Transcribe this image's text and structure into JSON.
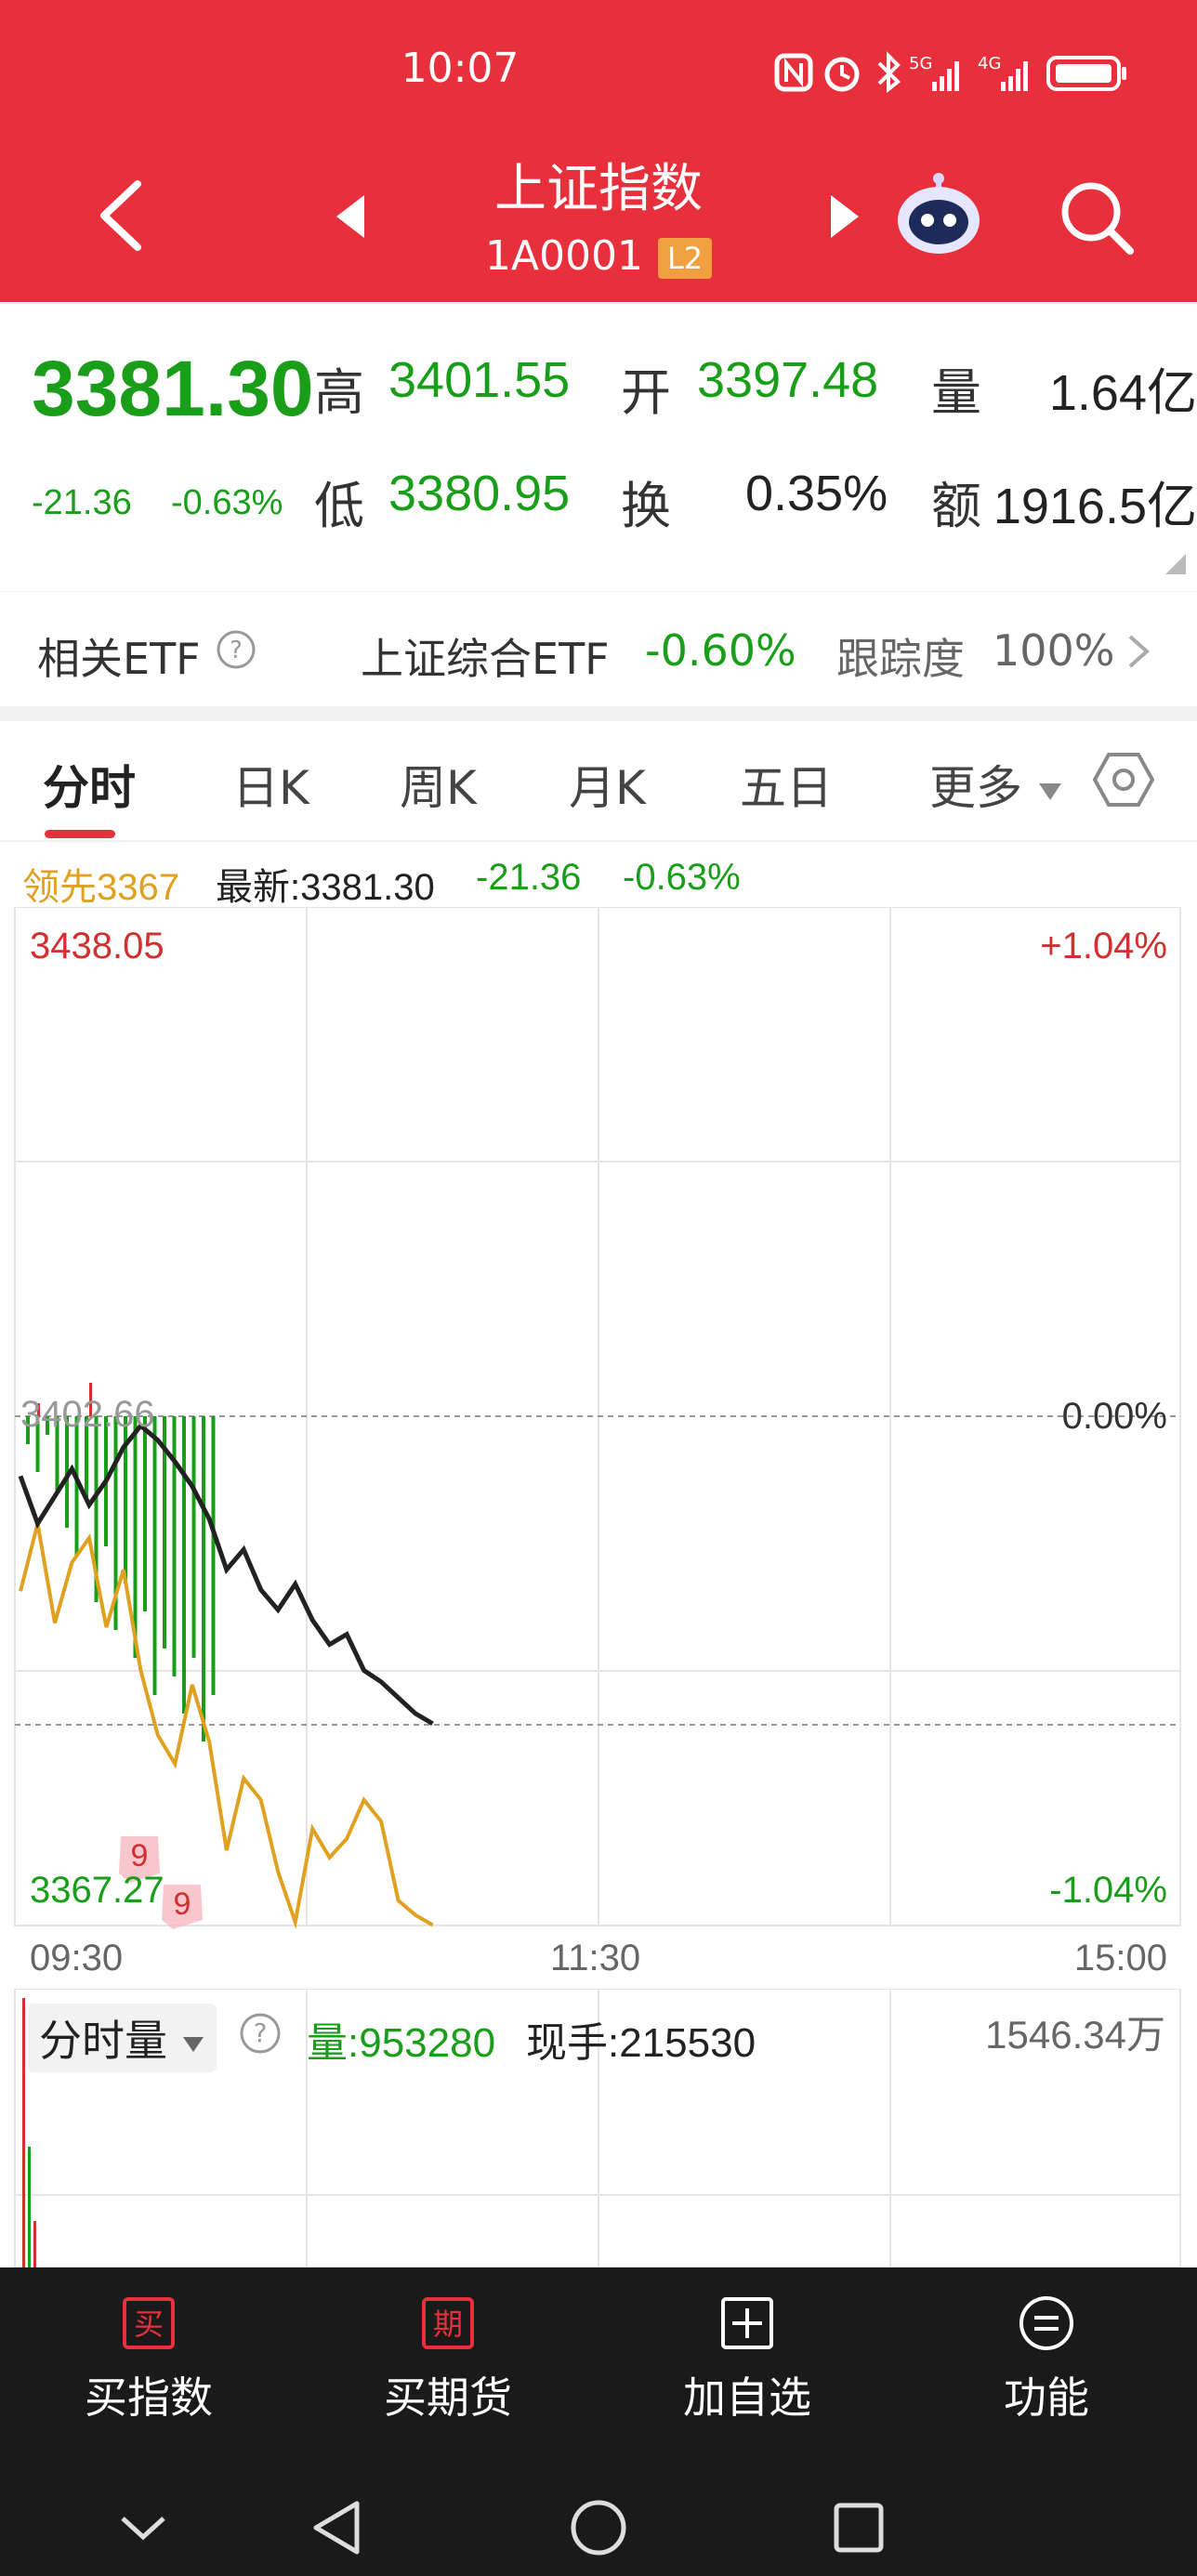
{
  "status_bar": {
    "time": "10:07"
  },
  "header": {
    "title": "上证指数",
    "code": "1A0001",
    "badge": "L2"
  },
  "quote": {
    "price": "3381.30",
    "change": "-21.36",
    "change_pct": "-0.63%",
    "high_label": "高",
    "high": "3401.55",
    "open_label": "开",
    "open": "3397.48",
    "volume_label": "量",
    "volume": "1.64亿",
    "low_label": "低",
    "low": "3380.95",
    "turnover_label": "换",
    "turnover": "0.35%",
    "amount_label": "额",
    "amount": "1916.5亿"
  },
  "etf": {
    "label": "相关ETF",
    "name": "上证综合ETF",
    "change": "-0.60%",
    "tracking_label": "跟踪度",
    "tracking": "100%"
  },
  "tabs": [
    "分时",
    "日K",
    "周K",
    "月K",
    "五日",
    "更多"
  ],
  "info": {
    "lead": "领先3367",
    "latest": "最新:3381.30",
    "change": "-21.36",
    "change_pct": "-0.63%"
  },
  "chart": {
    "top_value": "3438.05",
    "top_pct": "+1.04%",
    "mid_pct": "0.00%",
    "mid_value": "3402.66",
    "bottom_value": "3367.27",
    "bottom_pct": "-1.04%",
    "times": [
      "09:30",
      "11:30",
      "15:00"
    ],
    "marker": "9",
    "colors": {
      "price": "#222222",
      "lead": "#e0a020",
      "down": "#1a9e1a",
      "up": "#d03030"
    }
  },
  "chart_data": {
    "type": "line",
    "ylim": [
      3367.27,
      3438.05
    ],
    "series": [
      {
        "values": [
          3398.5,
          3395.2,
          3397.1,
          3399.0,
          3396.5,
          3398.2,
          3400.5,
          3402.0,
          3401.0,
          3399.5,
          3397.8,
          3395.5,
          3392.0,
          3393.4,
          3390.6,
          3389.2,
          3391.0,
          3388.5,
          3386.8,
          3387.5,
          3385.0,
          3384.2,
          3383.1,
          3382.0,
          3381.3
        ]
      },
      {
        "values": [
          3390.5,
          3395.2,
          3388.3,
          3392.5,
          3394.2,
          3388.0,
          3392.0,
          3385.0,
          3380.5,
          3378.5,
          3384.0,
          3380.0,
          3372.5,
          3377.5,
          3376.0,
          3371.0,
          3367.5,
          3374.0,
          3372.0,
          3373.3,
          3376.0,
          3374.5,
          3369.0,
          3368.0,
          3367.3
        ]
      }
    ]
  },
  "volume_panel": {
    "selector": "分时量",
    "volume": "量:953280",
    "current": "现手:215530",
    "max": "1546.34万"
  },
  "bottom_nav": [
    {
      "icon_text": "买",
      "label": "买指数"
    },
    {
      "icon_text": "期",
      "label": "买期货"
    },
    {
      "label": "加自选"
    },
    {
      "label": "功能"
    }
  ]
}
